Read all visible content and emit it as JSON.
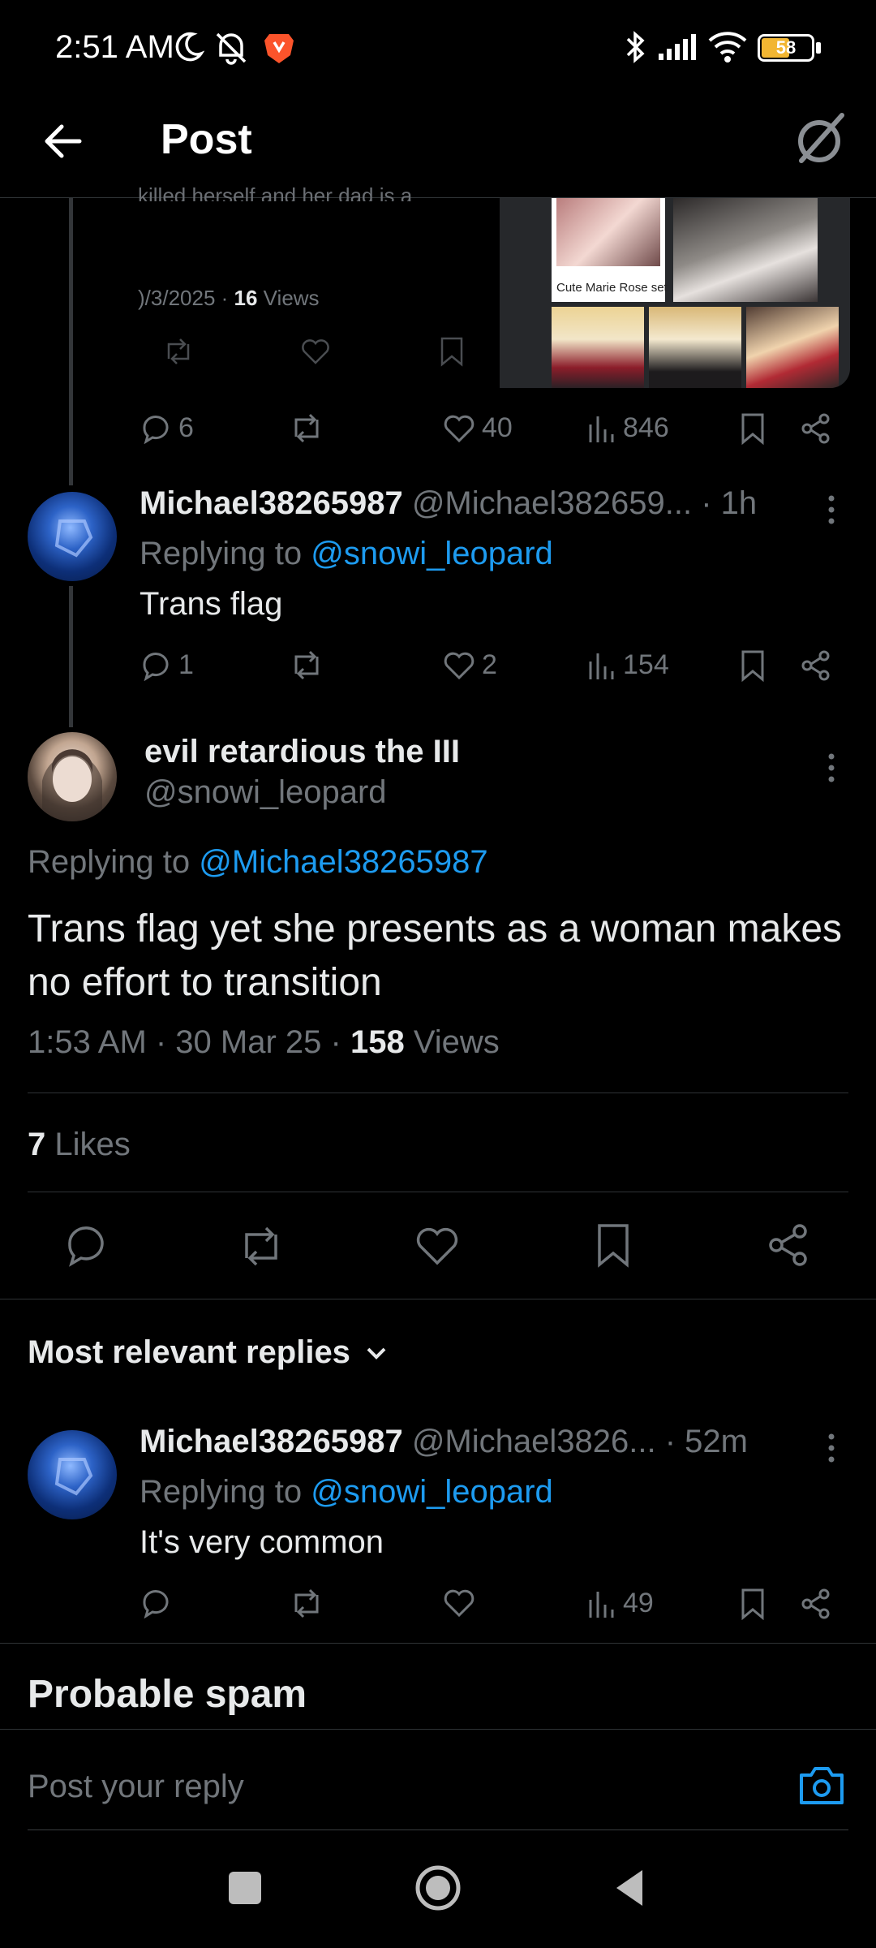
{
  "status_bar": {
    "time": "2:51 AM",
    "battery": "58"
  },
  "header": {
    "title": "Post"
  },
  "quoted_card": {
    "clipped_text": "killed herself and her dad is a",
    "date": ")/3/2025",
    "views_count": "16",
    "views_label": "Views",
    "image_caption": "Cute Marie Rose set"
  },
  "prev_post_actions": {
    "replies": "6",
    "likes": "40",
    "views": "846"
  },
  "reply1": {
    "username": "Michael38265987",
    "handle": "@Michael382659...",
    "time": "· 1h",
    "replying_prefix": "Replying to",
    "replying_to": "@snowi_leopard",
    "text": "Trans flag",
    "replies": "1",
    "likes": "2",
    "views": "154"
  },
  "main_post": {
    "display_name": "evil retardious the III",
    "handle": "@snowi_leopard",
    "replying_prefix": "Replying to",
    "replying_to": "@Michael38265987",
    "text": "Trans flag yet she presents as a woman makes no effort to transition",
    "timestamp": "1:53 AM · 30 Mar 25 · ",
    "views_count": "158",
    "views_label": "Views",
    "likes_count": "7",
    "likes_label": "Likes"
  },
  "replies_section": {
    "sort_label": "Most relevant replies"
  },
  "reply2": {
    "username": "Michael38265987",
    "handle": "@Michael3826...",
    "time": "· 52m",
    "replying_prefix": "Replying to",
    "replying_to": "@snowi_leopard",
    "text": "It's very common",
    "views": "49"
  },
  "spam_section": {
    "title": "Probable spam"
  },
  "composer": {
    "placeholder": "Post your reply"
  },
  "colors": {
    "accent": "#1d9bf0",
    "muted": "#71767b",
    "background": "#000000"
  }
}
